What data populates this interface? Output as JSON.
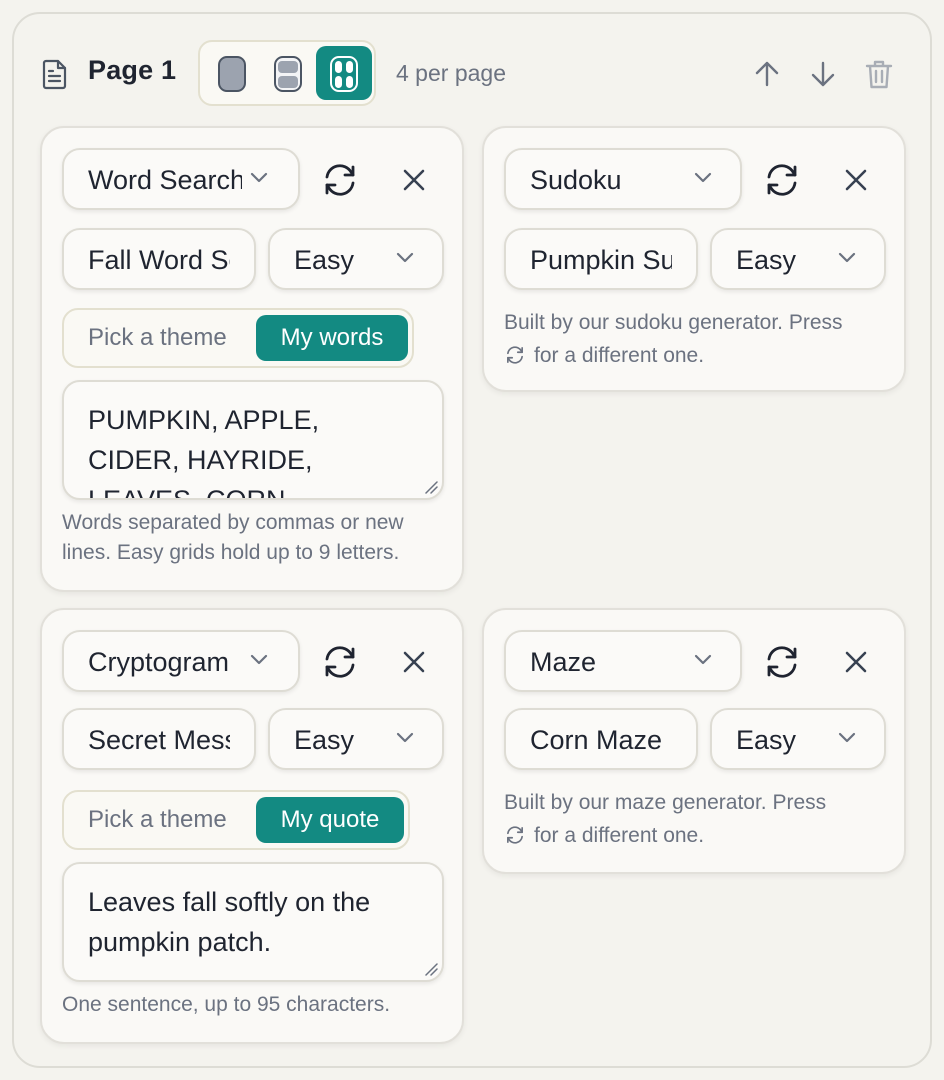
{
  "page": {
    "title": "Page 1",
    "per_page_label": "4 per page",
    "layout_options": [
      "one-per-page",
      "two-per-page",
      "four-per-page"
    ],
    "selected_layout": "four-per-page"
  },
  "colors": {
    "accent": "#138a82",
    "muted_text": "#6b7280",
    "text": "#1f2430",
    "background": "#f4f3ee"
  },
  "puzzles": [
    {
      "type": "Word Search",
      "title": "Fall Word Search",
      "difficulty": "Easy",
      "mode_options": [
        "Pick a theme",
        "My words"
      ],
      "selected_mode": "My words",
      "content": "PUMPKIN, APPLE, CIDER, HAYRIDE, LEAVES, CORN",
      "hint": "Words separated by commas or new lines. Easy grids hold up to 9 letters."
    },
    {
      "type": "Sudoku",
      "title": "Pumpkin Sudoku",
      "difficulty": "Easy",
      "note_before": "Built by our sudoku generator. Press",
      "note_after": "for a different one."
    },
    {
      "type": "Cryptogram",
      "title": "Secret Message",
      "difficulty": "Easy",
      "mode_options": [
        "Pick a theme",
        "My quote"
      ],
      "selected_mode": "My quote",
      "content": "Leaves fall softly on the pumpkin patch.",
      "hint": "One sentence, up to 95 characters."
    },
    {
      "type": "Maze",
      "title": "Corn Maze",
      "difficulty": "Easy",
      "note_before": "Built by our maze generator. Press",
      "note_after": "for a different one."
    }
  ]
}
